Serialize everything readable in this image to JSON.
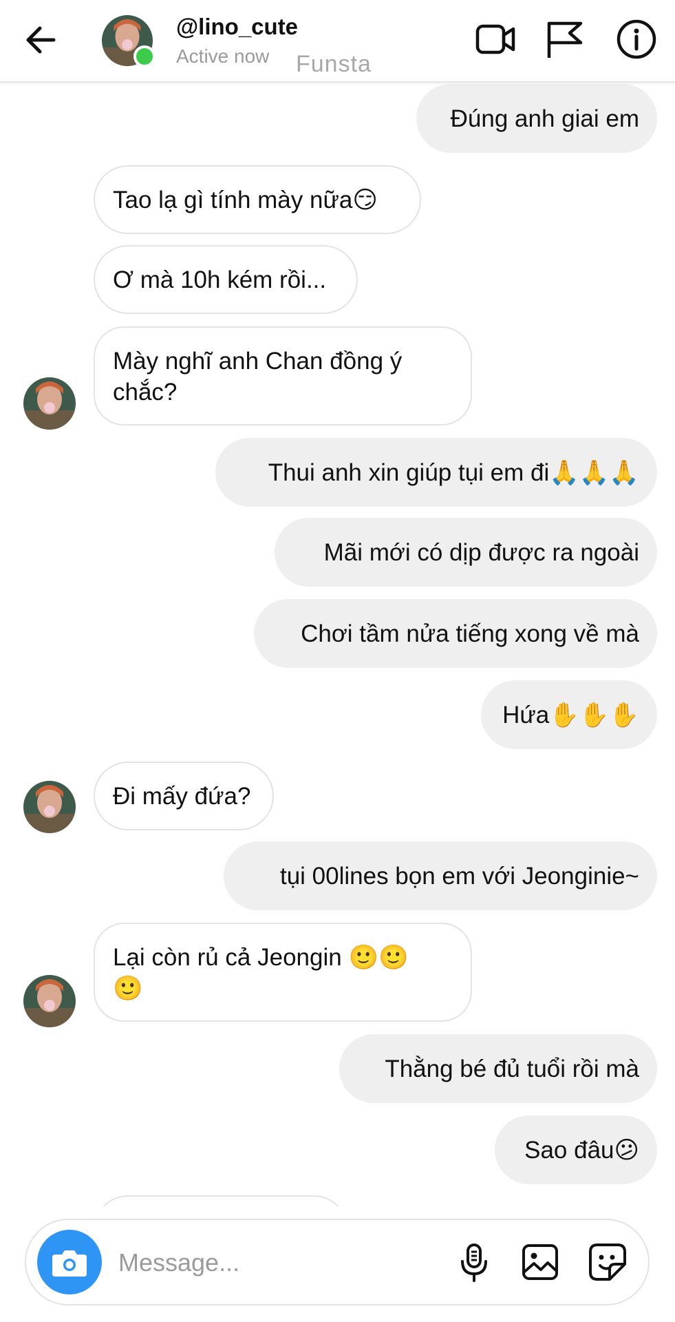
{
  "header": {
    "username": "@lino_cute",
    "status": "Active now",
    "watermark": "Funsta",
    "online_color": "#3ccb4a",
    "icons": [
      "back-arrow-icon",
      "video-camera-icon",
      "flag-icon",
      "info-icon"
    ]
  },
  "messages": [
    {
      "side": "out",
      "text": "Đúng anh giai em"
    },
    {
      "side": "in",
      "text": "Tao lạ gì tính mày nữa😏"
    },
    {
      "side": "in",
      "text": "Ơ mà 10h kém rồi..."
    },
    {
      "side": "in",
      "text": "Mày nghĩ anh Chan đồng ý\nchắc?"
    },
    {
      "side": "out",
      "text": "Thui anh xin giúp tụi em đi🙏🙏🙏"
    },
    {
      "side": "out",
      "text": "Mãi mới có dịp được ra ngoài"
    },
    {
      "side": "out",
      "text": "Chơi tầm nửa tiếng xong về mà"
    },
    {
      "side": "out",
      "text": "Hứa✋✋✋"
    },
    {
      "side": "in",
      "text": "Đi mấy đứa?"
    },
    {
      "side": "out",
      "text": "tụi 00lines bọn em với Jeonginie~"
    },
    {
      "side": "in",
      "text": "Lại còn rủ cả Jeongin 🙂🙂\n🙂"
    },
    {
      "side": "out",
      "text": "Thằng bé đủ tuổi rồi mà"
    },
    {
      "side": "out",
      "text": "Sao đâu😕"
    }
  ],
  "composer": {
    "placeholder": "Message...",
    "camera_color": "#2f95f4",
    "icons": [
      "camera-icon",
      "microphone-icon",
      "gallery-icon",
      "sticker-icon"
    ]
  },
  "colors": {
    "outgoing_bubble": "#efefef",
    "incoming_border": "#e3e3e3",
    "secondary_text": "#9a9a9a"
  }
}
